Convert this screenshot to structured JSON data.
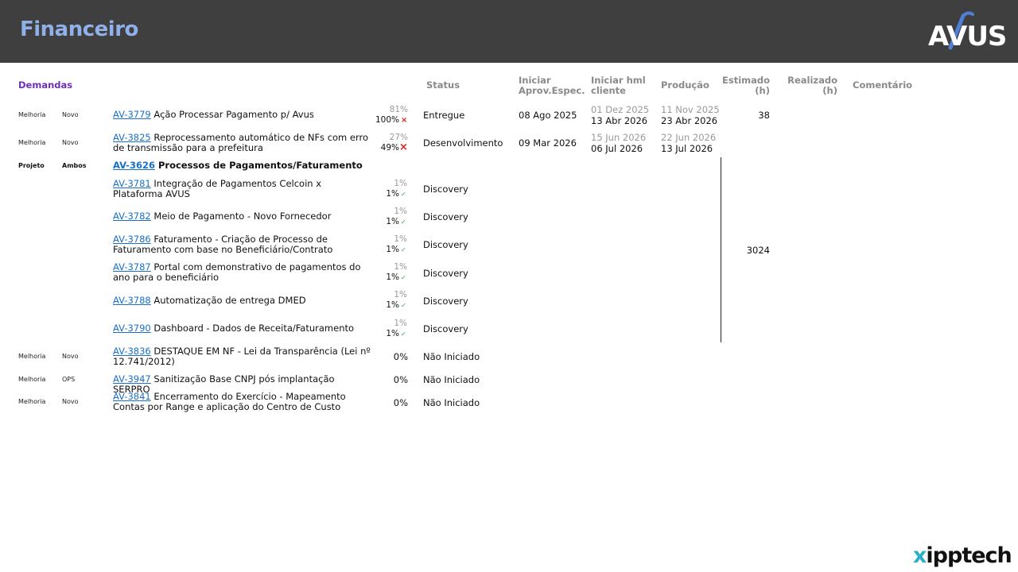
{
  "header": {
    "title": "Financeiro",
    "logo_text": "AVUS"
  },
  "columns": {
    "demandas": "Demandas",
    "status": "Status",
    "iniciar_aprov": "Iniciar Aprov.Espec.",
    "iniciar_hml": "Iniciar hml cliente",
    "producao": "Produção",
    "estimado": "Estimado (h)",
    "realizado": "Realizado (h)",
    "comentario": "Comentário"
  },
  "rows": [
    {
      "tipo": "Melhoria",
      "origem": "Novo",
      "id": "AV-3779",
      "desc": "Ação Processar Pagamento p/ Avus",
      "pct_prev": "81%",
      "pct": "100%",
      "status": "Entregue",
      "aprov": "08 Ago 2025",
      "hml_prev": "01 Dez 2025",
      "hml": "13 Abr 2026",
      "prod_prev": "11 Nov 2025",
      "prod": "23 Abr 2026",
      "estimado": "38"
    },
    {
      "tipo": "Melhoria",
      "origem": "Novo",
      "id": "AV-3825",
      "desc": " Reprocessamento automático de NFs com erro de transmissão para a prefeitura",
      "pct_prev": "27%",
      "pct": "49%",
      "status": "Desenvolvimento",
      "aprov": "09 Mar 2026",
      "hml_prev": "15 Jun 2026",
      "hml": "06 Jul 2026",
      "prod_prev": "22 Jun 2026",
      "prod": "13 Jul 2026"
    },
    {
      "tipo": "Projeto",
      "origem": "Ambos",
      "id": "AV-3626",
      "desc": "Processos de Pagamentos/Faturamento",
      "estimado": "3024"
    },
    {
      "id": "AV-3781",
      "desc": "Integração de Pagamentos Celcoin x Plataforma AVUS",
      "pct_prev": "1%",
      "pct": "1%",
      "status": "Discovery"
    },
    {
      "id": "AV-3782",
      "desc": "Meio de Pagamento - Novo Fornecedor",
      "pct_prev": "1%",
      "pct": "1%",
      "status": "Discovery"
    },
    {
      "id": "AV-3786",
      "desc": "Faturamento - Criação de Processo de Faturamento com base no Beneficiário/Contrato",
      "pct_prev": "1%",
      "pct": "1%",
      "status": "Discovery"
    },
    {
      "id": "AV-3787",
      "desc": "Portal com demonstrativo de pagamentos do ano para o beneficiário",
      "pct_prev": "1%",
      "pct": "1%",
      "status": "Discovery"
    },
    {
      "id": "AV-3788",
      "desc": "Automatização de entrega DMED",
      "pct_prev": "1%",
      "pct": "1%",
      "status": "Discovery"
    },
    {
      "id": "AV-3790",
      "desc": "Dashboard - Dados de Receita/Faturamento",
      "pct_prev": "1%",
      "pct": "1%",
      "status": "Discovery"
    },
    {
      "tipo": "Melhoria",
      "origem": "Novo",
      "id": "AV-3836",
      "desc": "DESTAQUE EM NF - Lei da Transparência (Lei nº 12.741/2012)",
      "pct": "0%",
      "status": "Não Iniciado"
    },
    {
      "tipo": "Melhoria",
      "origem": "OPS",
      "id": "AV-3947",
      "desc": "Sanitização Base CNPJ pós implantação SERPRO",
      "pct": "0%",
      "status": "Não Iniciado"
    },
    {
      "tipo": "Melhoria",
      "origem": "Novo",
      "id": "AV-3841",
      "desc": "Encerramento do Exercício - Mapeamento Contas por Range e aplicação do Centro de Custo",
      "pct": "0%",
      "status": "Não Iniciado"
    }
  ],
  "markers": {
    "cross": "×",
    "check": "✓"
  },
  "colors": {
    "header_bg": "#3f3f3f",
    "title": "#8fb0e8",
    "link": "#1a70c8",
    "demandas": "#6f2dbd",
    "cross": "#d8231c",
    "check": "#2aa64a"
  },
  "footer": {
    "brand_x": "x",
    "brand_rest": "ipptech"
  }
}
